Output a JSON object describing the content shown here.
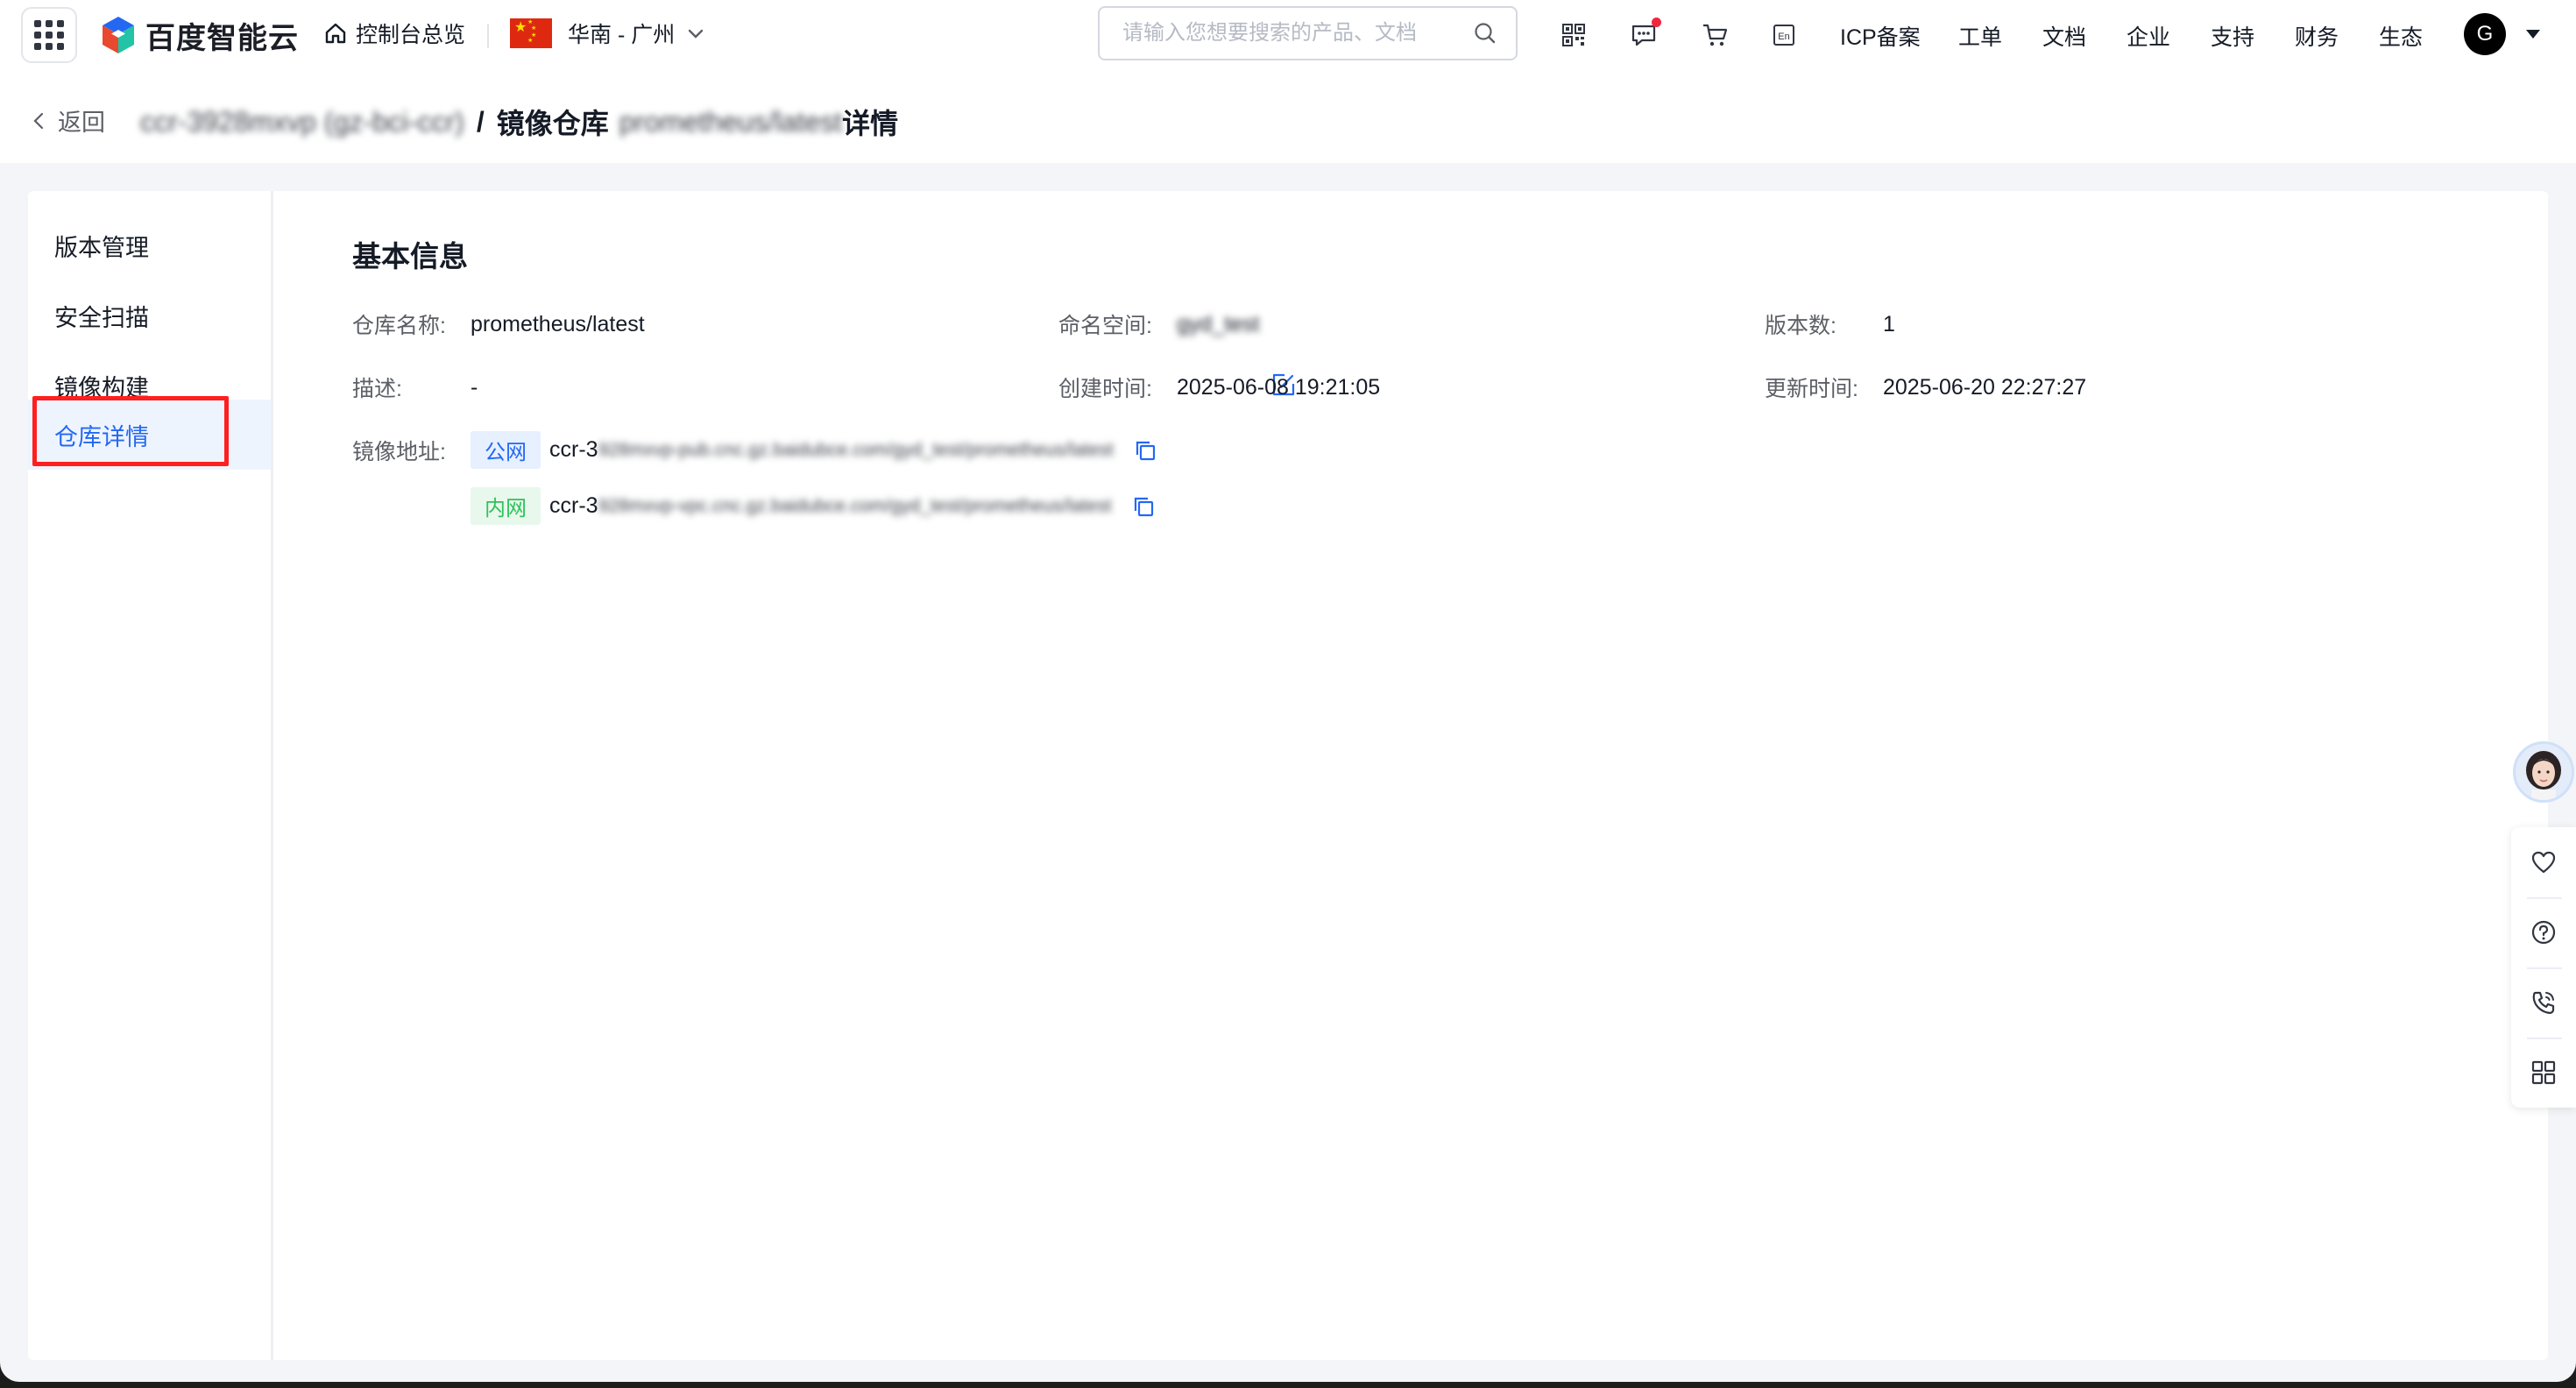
{
  "topbar": {
    "logo_text": "百度智能云",
    "home_label": "控制台总览",
    "region_label": "华南 - 广州",
    "search_placeholder": "请输入您想要搜索的产品、文档",
    "links": [
      "ICP备案",
      "工单",
      "文档",
      "企业",
      "支持",
      "财务",
      "生态"
    ],
    "avatar_letter": "G",
    "icons": [
      "qrcode-icon",
      "message-icon",
      "cart-icon",
      "language-en-icon"
    ],
    "message_badge": true
  },
  "breadcrumb": {
    "back_label": "返回",
    "instance": "ccr-3928mxvp (gz-bci-ccr)",
    "separator": "/",
    "repo_prefix": "镜像仓库",
    "repo_name": "prometheus/latest",
    "suffix": "详情"
  },
  "sidebar": {
    "items": [
      {
        "label": "版本管理",
        "active": false
      },
      {
        "label": "安全扫描",
        "active": false
      },
      {
        "label": "镜像构建",
        "active": false
      },
      {
        "label": "仓库详情",
        "active": true
      }
    ]
  },
  "basic_info": {
    "title": "基本信息",
    "repo_name_label": "仓库名称:",
    "repo_name_value": "prometheus/latest",
    "namespace_label": "命名空间:",
    "namespace_value": "gyd_test",
    "version_count_label": "版本数:",
    "version_count_value": "1",
    "desc_label": "描述:",
    "desc_value": "-",
    "created_label": "创建时间:",
    "created_value": "2025-06-08 19:21:05",
    "updated_label": "更新时间:",
    "updated_value": "2025-06-20 22:27:27",
    "address_label": "镜像地址:",
    "public_tag": "公网",
    "public_prefix": "ccr-3",
    "public_rest": "928mxvp-pub.cnc.gz.baidubce.com/gyd_test/prometheus/latest",
    "private_tag": "内网",
    "private_prefix": "ccr-3",
    "private_rest": "928mxvp-vpc.cnc.gz.baidubce.com/gyd_test/prometheus/latest"
  },
  "colors": {
    "accent": "#2468f2",
    "highlight_border": "#ff1f1f",
    "public_tag_bg": "#e6f0ff",
    "private_tag_bg": "#e8f8ec",
    "private_tag_fg": "#2fc25b"
  },
  "float_bar": {
    "icons": [
      "heart-icon",
      "help-icon",
      "phone-icon",
      "apps-icon"
    ]
  }
}
